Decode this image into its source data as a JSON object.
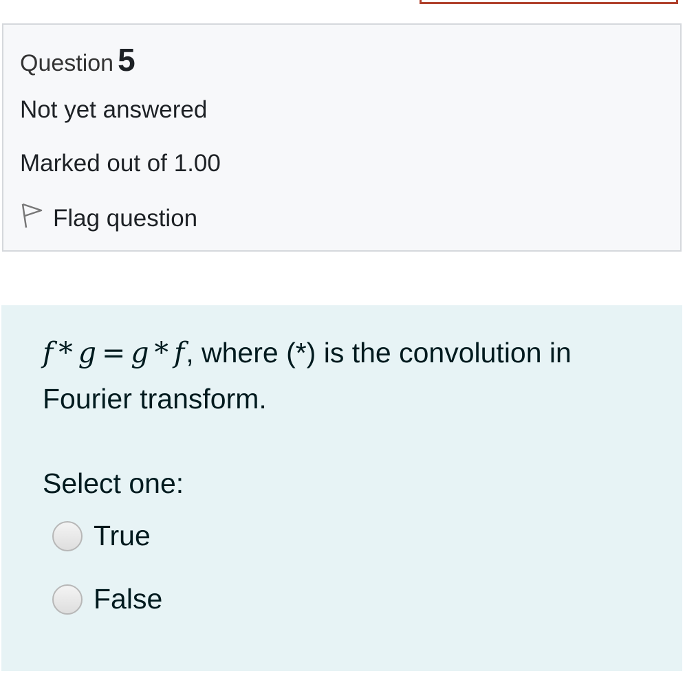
{
  "question": {
    "label": "Question",
    "number": "5",
    "state": "Not yet answered",
    "grade": "Marked out of 1.00",
    "flag_label": "Flag question"
  },
  "content": {
    "formula": {
      "f1": "f",
      "star1": "*",
      "g1": "g",
      "eq": "=",
      "g2": "g",
      "star2": "*",
      "f2": "f"
    },
    "text_after_formula": ", where (*)  is the convolution in Fourier transform.",
    "prompt": "Select one:",
    "options": [
      {
        "label": "True",
        "selected": false
      },
      {
        "label": "False",
        "selected": false
      }
    ]
  },
  "icons": {
    "flag": "flag-outline-icon",
    "radio": "radio-unchecked-icon"
  },
  "colors": {
    "info_background": "#f7f8fa",
    "content_background": "#e7f3f5",
    "top_border": "#b0412c"
  }
}
